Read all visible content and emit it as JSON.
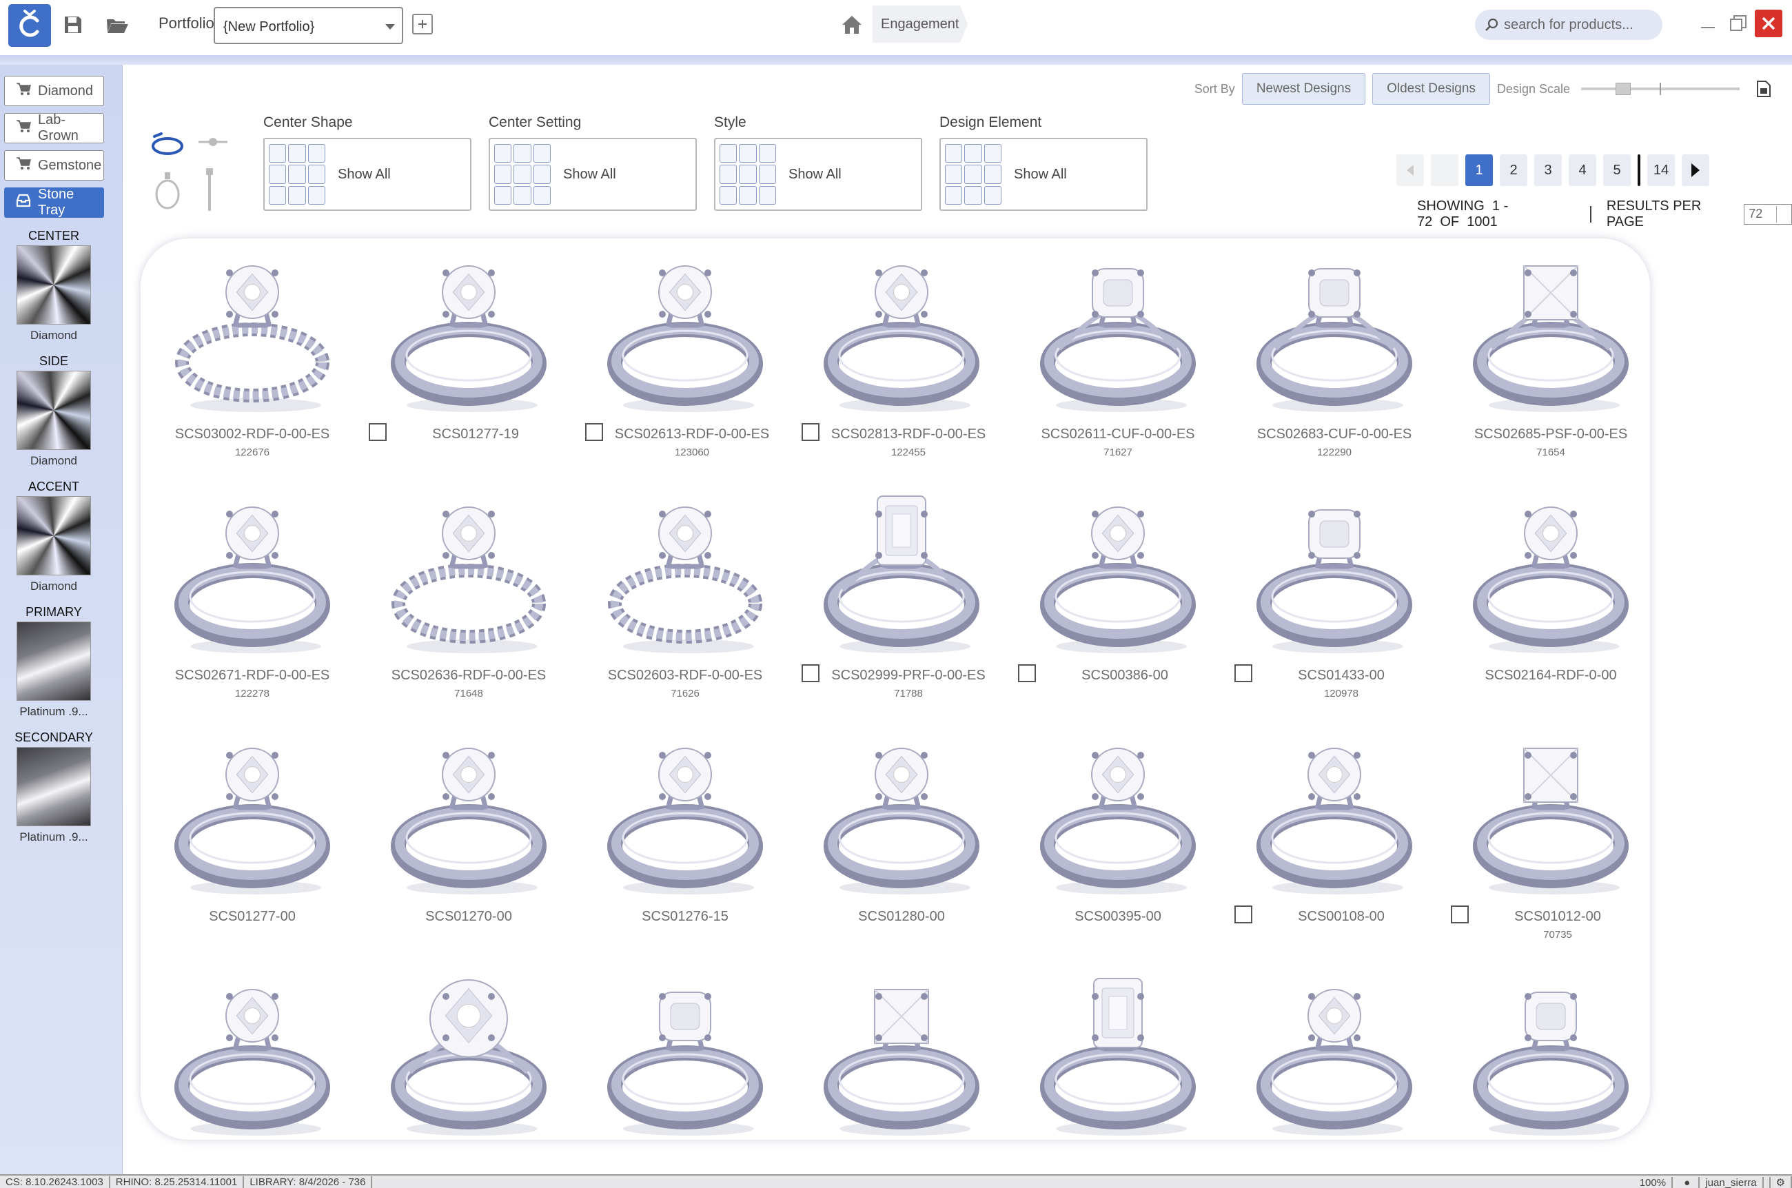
{
  "titlebar": {
    "portfolio_label": "Portfolio",
    "portfolio_value": "{New Portfolio}",
    "breadcrumb": "Engagement",
    "search_placeholder": "search for products..."
  },
  "sidebar": {
    "buttons": [
      {
        "label": "Diamond",
        "icon": "cart-icon"
      },
      {
        "label": "Lab-Grown",
        "icon": "cart-icon"
      },
      {
        "label": "Gemstone",
        "icon": "cart-icon"
      },
      {
        "label": "Stone Tray",
        "icon": "tray-icon",
        "active": true
      }
    ],
    "stones": [
      {
        "heading": "CENTER",
        "caption": "Diamond",
        "kind": "diamond"
      },
      {
        "heading": "SIDE",
        "caption": "Diamond",
        "kind": "diamond"
      },
      {
        "heading": "ACCENT",
        "caption": "Diamond",
        "kind": "diamond"
      },
      {
        "heading": "PRIMARY",
        "caption": "Platinum .9...",
        "kind": "metal"
      },
      {
        "heading": "SECONDARY",
        "caption": "Platinum .9...",
        "kind": "metal"
      }
    ]
  },
  "sort": {
    "label": "Sort By",
    "newest": "Newest Designs",
    "oldest": "Oldest Designs",
    "scale_label": "Design Scale"
  },
  "filters": [
    {
      "title": "Center Shape",
      "value": "Show All"
    },
    {
      "title": "Center Setting",
      "value": "Show All"
    },
    {
      "title": "Style",
      "value": "Show All"
    },
    {
      "title": "Design Element",
      "value": "Show All"
    }
  ],
  "pager": {
    "pages": [
      "1",
      "2",
      "3",
      "4",
      "5"
    ],
    "last": "14",
    "current": "1",
    "showing_label": "SHOWING",
    "range": "1 - 72",
    "of_label": "OF",
    "total": "1001",
    "rpp_label": "RESULTS PER PAGE",
    "rpp_value": "72"
  },
  "products": [
    {
      "name": "SCS03002-RDF-0-00-ES",
      "id": "122676",
      "check": false,
      "shank": "twist",
      "stone": "round"
    },
    {
      "name": "SCS01277-19",
      "id": "",
      "check": true,
      "shank": "plain",
      "stone": "round"
    },
    {
      "name": "SCS02613-RDF-0-00-ES",
      "id": "123060",
      "check": true,
      "shank": "plain",
      "stone": "round"
    },
    {
      "name": "SCS02813-RDF-0-00-ES",
      "id": "122455",
      "check": true,
      "shank": "plain",
      "stone": "round"
    },
    {
      "name": "SCS02611-CUF-0-00-ES",
      "id": "71627",
      "check": false,
      "shank": "split",
      "stone": "cushion"
    },
    {
      "name": "SCS02683-CUF-0-00-ES",
      "id": "122290",
      "check": false,
      "shank": "split",
      "stone": "cushion"
    },
    {
      "name": "SCS02685-PSF-0-00-ES",
      "id": "71654",
      "check": false,
      "shank": "split",
      "stone": "princess"
    },
    {
      "name": "SCS02671-RDF-0-00-ES",
      "id": "122278",
      "check": false,
      "shank": "plain",
      "stone": "round"
    },
    {
      "name": "SCS02636-RDF-0-00-ES",
      "id": "71648",
      "check": false,
      "shank": "twist",
      "stone": "round"
    },
    {
      "name": "SCS02603-RDF-0-00-ES",
      "id": "71626",
      "check": false,
      "shank": "twist",
      "stone": "round"
    },
    {
      "name": "SCS02999-PRF-0-00-ES",
      "id": "71788",
      "check": true,
      "shank": "split",
      "stone": "emerald"
    },
    {
      "name": "SCS00386-00",
      "id": "",
      "check": true,
      "shank": "plain",
      "stone": "round"
    },
    {
      "name": "SCS01433-00",
      "id": "120978",
      "check": true,
      "shank": "plain",
      "stone": "cushion"
    },
    {
      "name": "SCS02164-RDF-0-00",
      "id": "",
      "check": false,
      "shank": "plain",
      "stone": "round"
    },
    {
      "name": "SCS01277-00",
      "id": "",
      "check": false,
      "shank": "plain",
      "stone": "round"
    },
    {
      "name": "SCS01270-00",
      "id": "",
      "check": false,
      "shank": "plain",
      "stone": "round"
    },
    {
      "name": "SCS01276-15",
      "id": "",
      "check": false,
      "shank": "plain",
      "stone": "round"
    },
    {
      "name": "SCS01280-00",
      "id": "",
      "check": false,
      "shank": "plain",
      "stone": "round"
    },
    {
      "name": "SCS00395-00",
      "id": "",
      "check": false,
      "shank": "plain",
      "stone": "round"
    },
    {
      "name": "SCS00108-00",
      "id": "",
      "check": true,
      "shank": "plain",
      "stone": "round"
    },
    {
      "name": "SCS01012-00",
      "id": "70735",
      "check": true,
      "shank": "plain",
      "stone": "princess"
    },
    {
      "name": "",
      "id": "",
      "check": false,
      "shank": "plain",
      "stone": "round"
    },
    {
      "name": "",
      "id": "",
      "check": false,
      "shank": "split",
      "stone": "round-large"
    },
    {
      "name": "",
      "id": "",
      "check": false,
      "shank": "plain",
      "stone": "cushion"
    },
    {
      "name": "",
      "id": "",
      "check": false,
      "shank": "plain",
      "stone": "princess"
    },
    {
      "name": "",
      "id": "",
      "check": false,
      "shank": "plain",
      "stone": "emerald"
    },
    {
      "name": "",
      "id": "",
      "check": false,
      "shank": "plain",
      "stone": "round"
    },
    {
      "name": "",
      "id": "",
      "check": false,
      "shank": "plain",
      "stone": "cushion"
    }
  ],
  "statusbar": {
    "items": [
      "CS: 8.10.26243.1003",
      "RHINO: 8.25.25314.11001",
      "LIBRARY: 8/4/2026 - 736"
    ],
    "zoom": "100%",
    "user": "juan_sierra"
  },
  "colors": {
    "accent": "#3f6fc7",
    "sidebar_bg": "#ccd6f1",
    "close_button": "#d9322d",
    "ring_metal": "#b9bbd2"
  }
}
